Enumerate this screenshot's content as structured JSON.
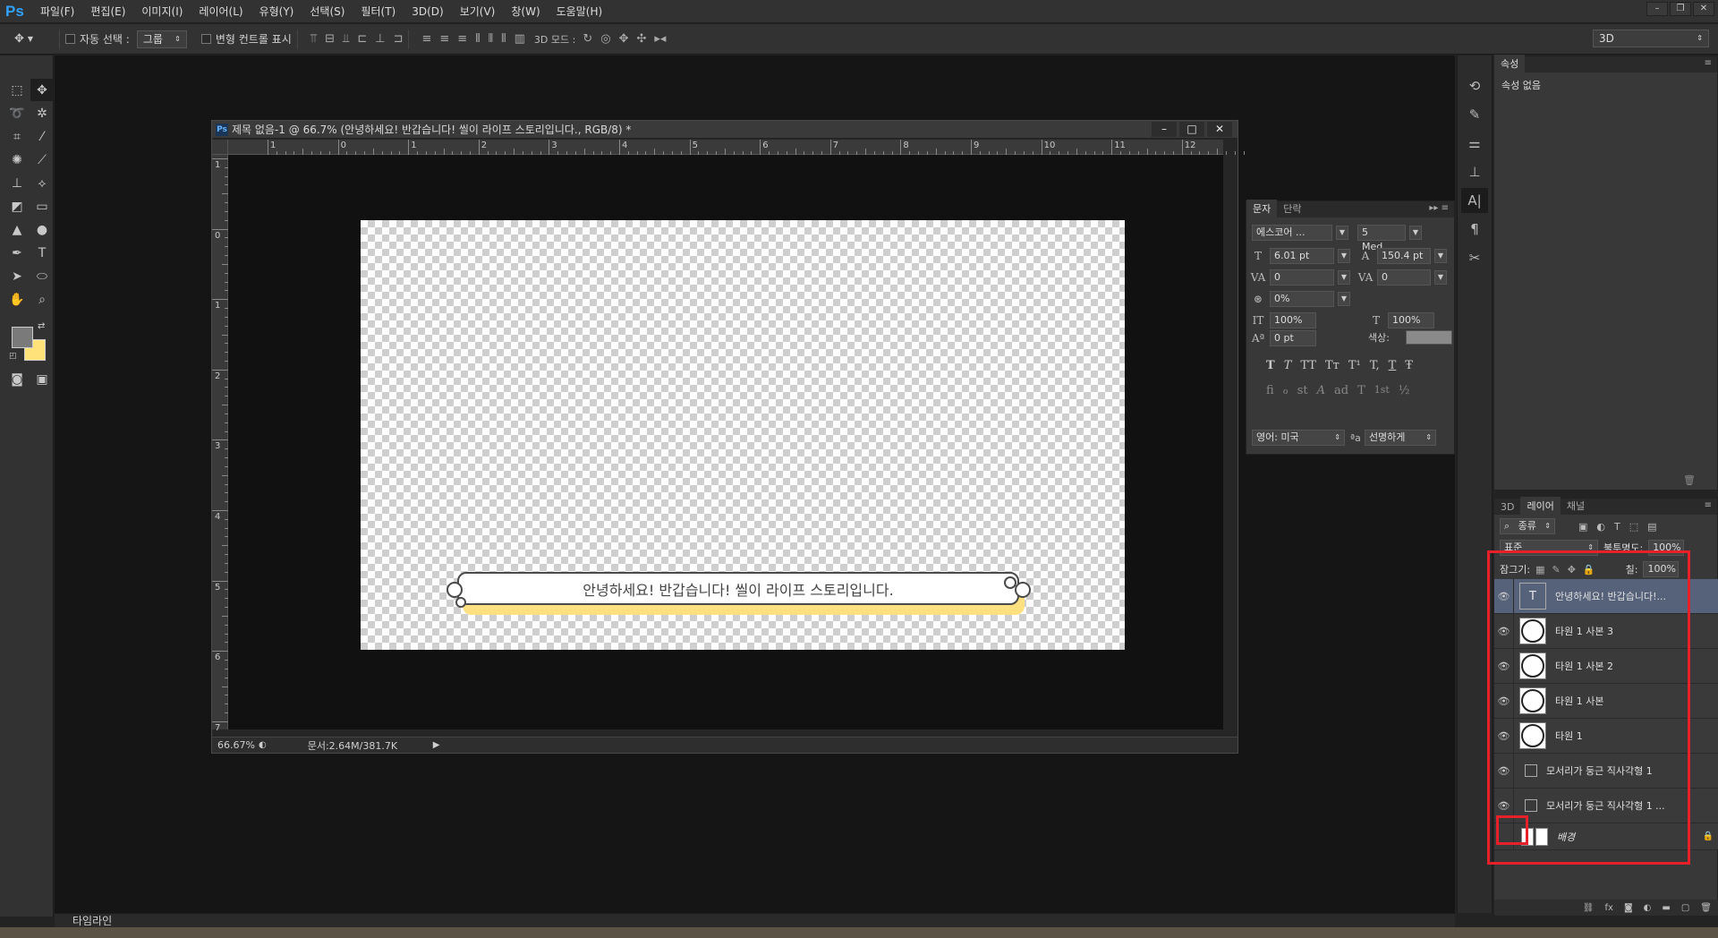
{
  "app": {
    "logo": "Ps",
    "menus": [
      "파일(F)",
      "편집(E)",
      "이미지(I)",
      "레이어(L)",
      "유형(Y)",
      "선택(S)",
      "필터(T)",
      "3D(D)",
      "보기(V)",
      "창(W)",
      "도움말(H)"
    ]
  },
  "options_bar": {
    "auto_select_label": "자동 선택 :",
    "auto_select_value": "그룹",
    "transform_controls_label": "변형 컨트롤 표시",
    "mode3d_label": "3D 모드 :",
    "workspace_value": "3D"
  },
  "document": {
    "title": "제목 없음-1 @ 66.7% (안녕하세요! 반갑습니다! 씰이 라이프 스토리입니다., RGB/8) *",
    "ruler_top": [
      "1",
      "0",
      "1",
      "2",
      "3",
      "4",
      "5",
      "6",
      "7",
      "8",
      "9",
      "10",
      "11",
      "12"
    ],
    "ruler_left": [
      "1",
      "0",
      "1",
      "2",
      "3",
      "4",
      "5",
      "6",
      "7"
    ],
    "banner_text": "안녕하세요! 반갑습니다! 씰이 라이프 스토리입니다.",
    "zoom": "66.67%",
    "doc_info": "문서:2.64M/381.7K"
  },
  "character_panel": {
    "tab_character": "문자",
    "tab_paragraph": "단락",
    "font_family": "에스코어 ...",
    "font_style": "5 Med...",
    "font_size": "6.01 pt",
    "leading": "150.4 pt",
    "kerning": "0",
    "tracking": "0",
    "tsume": "0%",
    "vertical_scale": "100%",
    "horizontal_scale": "100%",
    "baseline_shift": "0 pt",
    "color_label": "색상:",
    "style_buttons": [
      "T",
      "T",
      "TT",
      "Tт",
      "T¹",
      "T,",
      "T",
      "Ŧ"
    ],
    "opentype_buttons": [
      "ﬁ",
      "ℴ",
      "st",
      "A",
      "ad",
      "T",
      "1st",
      "½"
    ],
    "language": "영어: 미국",
    "aa_label": "ªa",
    "antialias": "선명하게"
  },
  "properties_panel": {
    "tab": "속성",
    "body": "속성 없음"
  },
  "layers_panel": {
    "tabs": [
      "3D",
      "레이어",
      "채널"
    ],
    "filter_label": "종류",
    "blend_mode": "표준",
    "opacity_label": "불투명도:",
    "opacity_value": "100%",
    "lock_label": "잠그기:",
    "fill_label": "칠:",
    "fill_value": "100%",
    "layers": [
      {
        "name": "안녕하세요! 반갑습니다!...",
        "kind": "text",
        "selected": true
      },
      {
        "name": "타원 1 사본 3",
        "kind": "ellipse"
      },
      {
        "name": "타원 1 사본 2",
        "kind": "ellipse"
      },
      {
        "name": "타원 1 사본",
        "kind": "ellipse"
      },
      {
        "name": "타원 1",
        "kind": "ellipse"
      },
      {
        "name": "모서리가 둥근 직사각형 1",
        "kind": "shape"
      },
      {
        "name": "모서리가 둥근 직사각형 1 ...",
        "kind": "shape"
      },
      {
        "name": "배경",
        "kind": "background"
      }
    ]
  },
  "timeline": {
    "label": "타임라인"
  },
  "colors": {
    "foreground": "#7a7a7a",
    "background": "#ffe27a",
    "highlight": "#e8202a",
    "banner_shadow": "#ffe080"
  }
}
